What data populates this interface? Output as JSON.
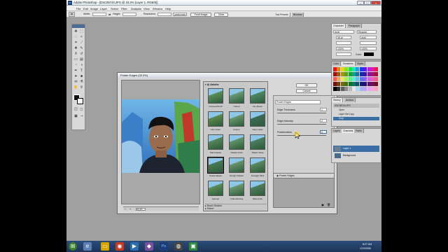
{
  "window": {
    "title": "Adobe Photoshop - [DSC05744.JPG @ 33.3% (Layer 1, RGB/8)]"
  },
  "menu": [
    "File",
    "Edit",
    "Image",
    "Layer",
    "Select",
    "Filter",
    "Analysis",
    "View",
    "Window",
    "Help"
  ],
  "options": {
    "width_label": "Width:",
    "height_label": "Height:",
    "resolution_label": "Resolution:",
    "resolution_unit": "pixels/inch",
    "front_image": "Front Image",
    "clear": "Clear"
  },
  "top_tabs": {
    "tool_presets": "Tool Presets",
    "brushes": "Brushes"
  },
  "dialog": {
    "title": "Poster Edges (33.3%)",
    "ok": "OK",
    "cancel": "Cancel",
    "folder": "Artistic",
    "zoom": "33.3%",
    "filters": [
      {
        "name": "Colored Pencil",
        "c": "#5b8f5a"
      },
      {
        "name": "Cutout",
        "c": "#6a9b7a"
      },
      {
        "name": "Dry Brush",
        "c": "#4f8862"
      },
      {
        "name": "Film Grain",
        "c": "#5e8a4e"
      },
      {
        "name": "Fresco",
        "c": "#6b9870"
      },
      {
        "name": "Neon Glow",
        "c": "#3d6b58"
      },
      {
        "name": "Paint Daubs",
        "c": "#578659"
      },
      {
        "name": "Palette Knife",
        "c": "#629367"
      },
      {
        "name": "Plastic Wrap",
        "c": "#4d7d62"
      },
      {
        "name": "Poster Edges",
        "c": "#4a7a55"
      },
      {
        "name": "Rough Pastels",
        "c": "#6a946c"
      },
      {
        "name": "Smudge Stick",
        "c": "#5a8a5e"
      },
      {
        "name": "Sponge",
        "c": "#5e8e5a"
      },
      {
        "name": "Underpainting",
        "c": "#6f9a74"
      },
      {
        "name": "Watercolor",
        "c": "#4f7e5f"
      }
    ],
    "other_folders": [
      "Brush Strokes",
      "Distort"
    ],
    "settings": {
      "filter_select": "Poster Edges",
      "params": [
        {
          "label": "Edge Thickness",
          "value": "1"
        },
        {
          "label": "Edge Intensity",
          "value": "2"
        },
        {
          "label": "Posterization",
          "value": "0"
        }
      ]
    },
    "effect_layer": "Poster Edges"
  },
  "character": {
    "tabs": [
      "Character",
      "Paragraph"
    ],
    "font": "Arial",
    "style": "Regular",
    "size": "36 pt",
    "leading": "Auto",
    "scale_v": "100%",
    "scale_h": "100%",
    "color_label": "Color:"
  },
  "swatches": {
    "tabs": [
      "Color",
      "Swatches",
      "Styles"
    ]
  },
  "history": {
    "tabs": [
      "History",
      "Actions"
    ],
    "items": [
      "DSC05744.JPG",
      "Open",
      "Layer Via Copy",
      "Crop"
    ]
  },
  "layers": {
    "tabs": [
      "Layers",
      "Channels",
      "Paths"
    ],
    "items": [
      "Layer 1",
      "Background"
    ]
  },
  "taskbar": {
    "time": "8:27 AM",
    "date": "12/15/2006"
  }
}
